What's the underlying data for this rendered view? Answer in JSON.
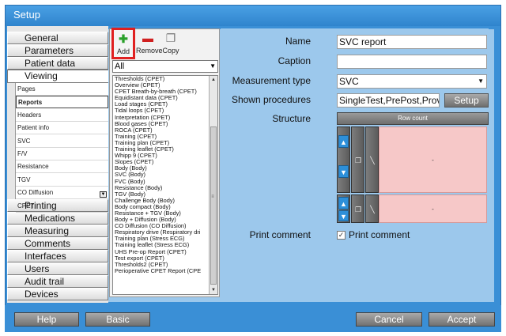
{
  "window": {
    "title": "Setup"
  },
  "categories": {
    "top": [
      "General",
      "Parameters",
      "Patient data",
      "Viewing"
    ],
    "bottom": [
      "Printing",
      "Medications",
      "Measuring",
      "Comments",
      "Interfaces",
      "Users",
      "Audit trail",
      "Devices"
    ]
  },
  "viewing_sub": {
    "items": [
      "Pages",
      "Reports",
      "Headers",
      "Patient info",
      "SVC",
      "F/V",
      "Resistance",
      "TGV",
      "CO Diffusion",
      "CPET"
    ],
    "selected": "Reports"
  },
  "toolbar": {
    "add_label": "Add",
    "remove_label": "Remove",
    "copy_label": "Copy"
  },
  "filter": {
    "value": "All"
  },
  "reports": [
    "Thresholds (CPET)",
    "Overview (CPET)",
    "CPET Breath-by-breath (CPET)",
    "Equidistant data (CPET)",
    "Load stages (CPET)",
    "Tidal loops (CPET)",
    "Interpretation (CPET)",
    "Blood gases (CPET)",
    "ROCA (CPET)",
    "Training (CPET)",
    "Training plan (CPET)",
    "Training leaflet (CPET)",
    "Whipp 9 (CPET)",
    "Slopes (CPET)",
    "Body (Body)",
    "SVC (Body)",
    "FVC (Body)",
    "Resistance (Body)",
    "TGV (Body)",
    "Challenge Body (Body)",
    "Body compact (Body)",
    "Resistance + TGV (Body)",
    "Body + Diffusion (Body)",
    "CO Diffusion (CO Diffusion)",
    "Respiratory drive (Respiratory dri",
    "Training plan (Stress ECG)",
    "Training leaflet (Stress ECG)",
    "UHS Pre-op Report (CPET)",
    "Test export (CPET)",
    "Thresholds2 (CPET)",
    "Perioperative CPET Report (CPE"
  ],
  "properties": {
    "name_label": "Name",
    "name_value": "SVC report",
    "caption_label": "Caption",
    "caption_value": "",
    "type_label": "Measurement type",
    "type_value": "SVC",
    "procedures_label": "Shown procedures",
    "procedures_value": "SingleTest,PrePost,Prov",
    "setup_label": "Setup",
    "structure_label": "Structure",
    "row_count_label": "Row count",
    "cell1_value": "-",
    "cell2_value": "-",
    "print_comment_label": "Print comment",
    "print_comment_checkbox_label": "Print comment",
    "print_comment_checked": true
  },
  "buttons": {
    "help": "Help",
    "basic": "Basic",
    "cancel": "Cancel",
    "accept": "Accept"
  },
  "colors": {
    "frame": "#3a8fd6",
    "panel": "#9cc8ec",
    "cell": "#f6c8c8",
    "accent_blue": "#2d8fd9",
    "highlight": "#e02020"
  }
}
